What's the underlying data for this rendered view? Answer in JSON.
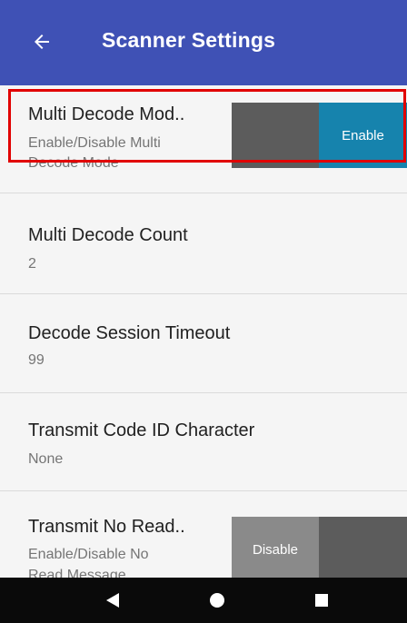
{
  "app": {
    "title": "Scanner Settings"
  },
  "settings": [
    {
      "title": "Multi Decode Mod..",
      "subtitle_line1": "Enable/Disable Multi",
      "subtitle_line2": "Decode Mode",
      "toggle": {
        "state": "on",
        "label": "Enable"
      }
    },
    {
      "title": "Multi Decode Count",
      "subtitle": "2"
    },
    {
      "title": "Decode Session Timeout",
      "subtitle": "99"
    },
    {
      "title": "Transmit Code ID Character",
      "subtitle": "None"
    },
    {
      "title": "Transmit No Read..",
      "subtitle_line1": "Enable/Disable No",
      "subtitle_line2": "Read Message",
      "toggle": {
        "state": "off",
        "label": "Disable"
      }
    }
  ],
  "navigation": {
    "icons": [
      "back-triangle-icon",
      "home-circle-icon",
      "recents-square-icon"
    ]
  },
  "colors": {
    "appbar": "#3f51b5",
    "toggle_on": "#1683ad",
    "highlight": "#e10000"
  }
}
